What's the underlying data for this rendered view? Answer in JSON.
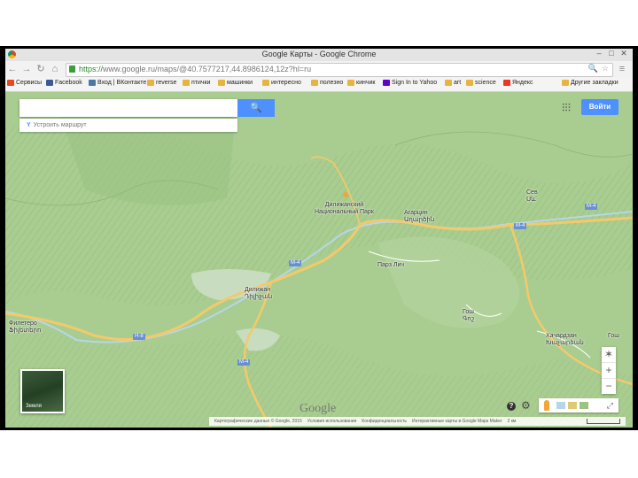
{
  "window": {
    "title": "Google Карты - Google Chrome",
    "controls": [
      "–",
      "□",
      "✕"
    ]
  },
  "toolbar": {
    "url_scheme": "https://",
    "url_rest": "www.google.ru/maps/@40.7577217,44.8986124,12z?hl=ru",
    "zoom_icon": "magnifier-icon",
    "star_icon": "star-icon"
  },
  "bookmarks": [
    {
      "label": "Сервисы",
      "icon": "apps-grid-icon",
      "color": "#e64a19"
    },
    {
      "label": "Facebook",
      "icon": "facebook-icon",
      "color": "#3b5998"
    },
    {
      "label": "Вход | ВКонтакте",
      "icon": "vk-icon",
      "color": "#4a76a8"
    },
    {
      "label": "reverse",
      "icon": "folder-icon",
      "color": "#e8b440"
    },
    {
      "label": "птички",
      "icon": "folder-icon",
      "color": "#e8b440"
    },
    {
      "label": "машинки",
      "icon": "folder-icon",
      "color": "#e8b440"
    },
    {
      "label": "интересно",
      "icon": "folder-icon",
      "color": "#e8b440"
    },
    {
      "label": "полезно",
      "icon": "folder-icon",
      "color": "#e8b440"
    },
    {
      "label": "кинчик",
      "icon": "folder-icon",
      "color": "#e8b440"
    },
    {
      "label": "Sign In to Yahoo",
      "icon": "yahoo-icon",
      "color": "#6001d2"
    },
    {
      "label": "art",
      "icon": "folder-icon",
      "color": "#e8b440"
    },
    {
      "label": "science",
      "icon": "folder-icon",
      "color": "#e8b440"
    },
    {
      "label": "Яндекс",
      "icon": "yandex-icon",
      "color": "#e32"
    },
    {
      "label": "Другие закладки",
      "icon": "folder-icon",
      "color": "#e8b440"
    }
  ],
  "map": {
    "search_placeholder": "",
    "search_button": "🔍",
    "routes_label": "Устроить маршрут",
    "signin_label": "Войти",
    "earth_label": "Земля",
    "logo": "Google",
    "zoom_in": "+",
    "zoom_out": "−",
    "compass": "✶",
    "help": "?",
    "gear": "⚙",
    "expand": "⤢",
    "places": [
      {
        "name": "Дилижанский\nНациональный Парк"
      },
      {
        "name": "Агарцин\nԱղարծին"
      },
      {
        "name": "Дилижан\nԴիլիջան"
      },
      {
        "name": "Филетеро\nՖիլետերո"
      },
      {
        "name": "Гош\nԳոշ"
      },
      {
        "name": "Хачардзан\nԽաչարձան"
      },
      {
        "name": "Сев\nՍև"
      },
      {
        "name": "Парз Лич"
      },
      {
        "name": "Гош"
      }
    ],
    "route_shields": [
      "M-4",
      "M-4",
      "H-8",
      "M-4",
      "M-4"
    ],
    "footer": [
      "Картографические данные © Google, 2015",
      "Условия использования",
      "Конфиденциальность",
      "Интерактивные карты в Google Maps Maker",
      "2 км"
    ],
    "colors": {
      "land": "#a9cd90",
      "forest": "#9bc383",
      "road": "#f5c96a",
      "river": "#b6d6ea",
      "accent": "#4d90fe"
    }
  }
}
